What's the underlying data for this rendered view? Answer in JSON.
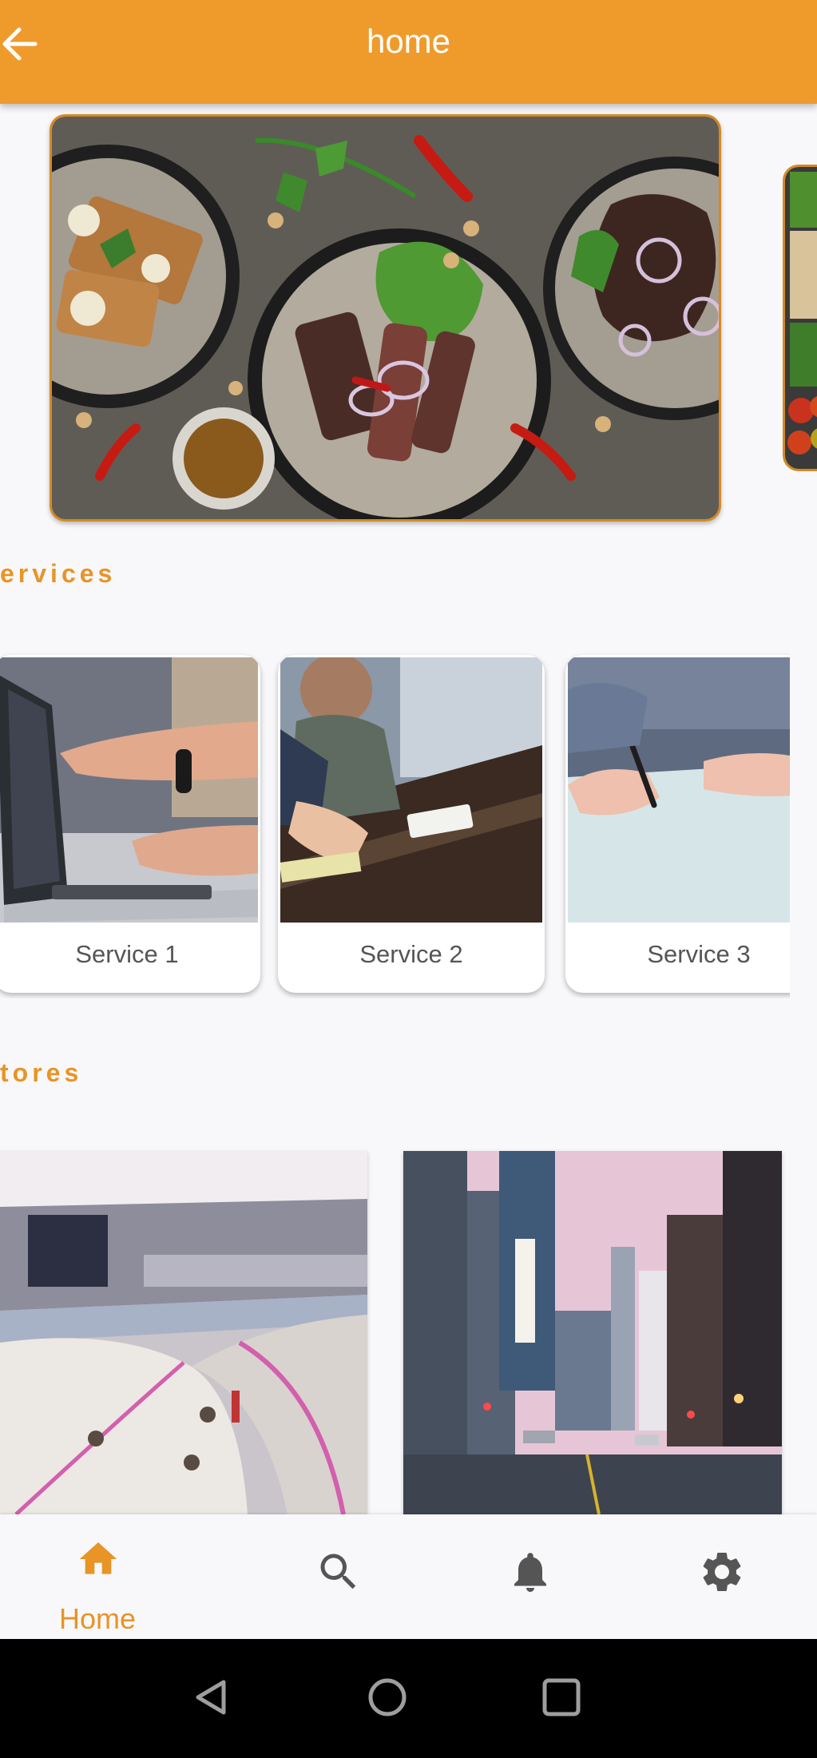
{
  "appbar": {
    "title": "home"
  },
  "sections": {
    "services_title": "ervices",
    "stores_title": "tores"
  },
  "services": [
    {
      "label": "Service 1"
    },
    {
      "label": "Service 2"
    },
    {
      "label": "Service 3"
    }
  ],
  "bottom_nav": {
    "items": [
      {
        "label": "Home",
        "icon": "home-icon",
        "active": true
      },
      {
        "label": "",
        "icon": "search-icon",
        "active": false
      },
      {
        "label": "",
        "icon": "bell-icon",
        "active": false
      },
      {
        "label": "",
        "icon": "gear-icon",
        "active": false
      }
    ]
  },
  "colors": {
    "accent": "#ef9b2c",
    "inactive_icon": "#555555",
    "background": "#f8f8fa"
  }
}
